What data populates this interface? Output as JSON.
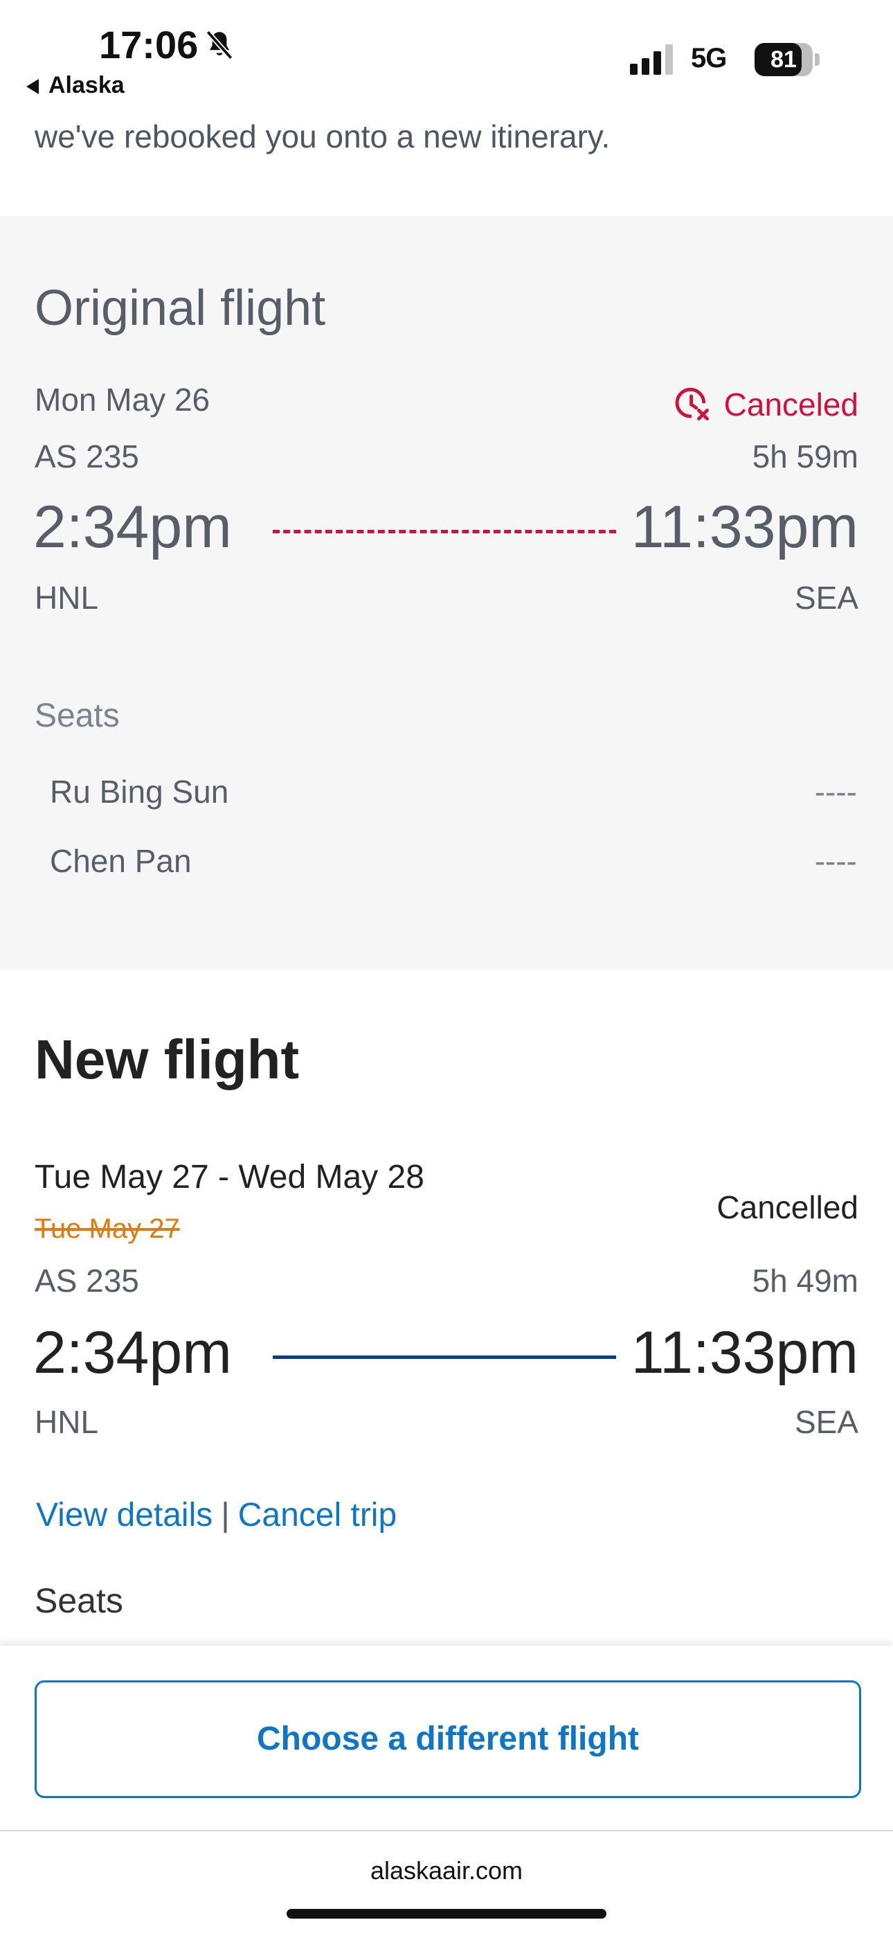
{
  "status_bar": {
    "time": "17:06",
    "back_app": "Alaska",
    "network": "5G",
    "battery_percent": "81",
    "battery_level": 0.81,
    "icons": [
      "bell-slash-icon",
      "signal-icon",
      "battery-icon"
    ]
  },
  "intro_text": "we've rebooked you onto a new itinerary.",
  "original_flight": {
    "title": "Original flight",
    "date": "Mon May 26",
    "status": "Canceled",
    "flight_number": "AS 235",
    "duration": "5h 59m",
    "depart_time": "2:34pm",
    "arrive_time": "11:33pm",
    "origin": "HNL",
    "destination": "SEA",
    "seats_label": "Seats",
    "passengers": [
      {
        "name": "Ru Bing Sun",
        "seat": "----"
      },
      {
        "name": "Chen Pan",
        "seat": "----"
      }
    ]
  },
  "new_flight": {
    "title": "New flight",
    "date": "Tue May 27 - Wed May 28",
    "old_date": "Tue May 27",
    "status": "Cancelled",
    "flight_number": "AS 235",
    "duration": "5h 49m",
    "depart_time": "2:34pm",
    "arrive_time": "11:33pm",
    "origin": "HNL",
    "destination": "SEA",
    "view_details_label": "View details",
    "separator": "|",
    "cancel_trip_label": "Cancel trip",
    "seats_label": "Seats"
  },
  "choose_button_label": "Choose a different flight",
  "url": "alaskaair.com",
  "colors": {
    "accent_blue": "#0f76c6",
    "cancel_red": "#d0113b",
    "orange_strike": "#e07a12",
    "route_navy": "#0a3e80"
  }
}
